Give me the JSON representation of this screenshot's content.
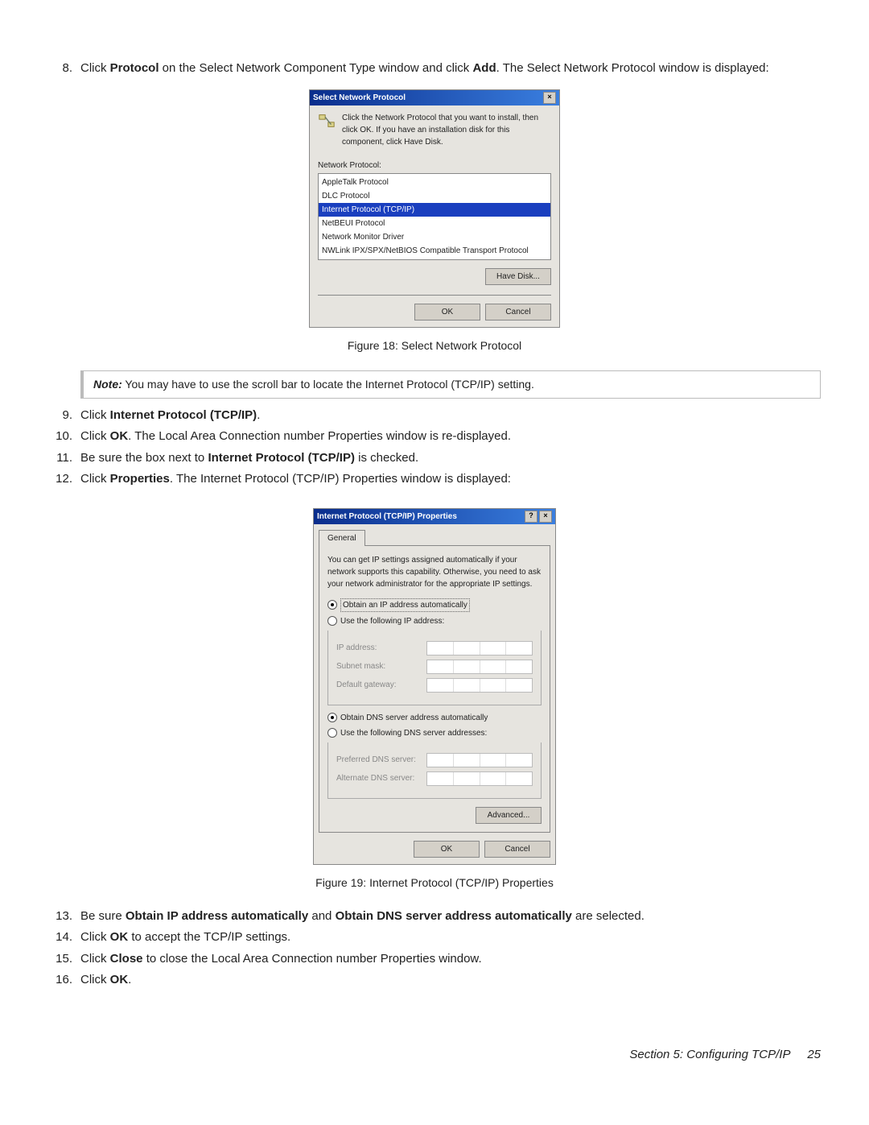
{
  "steps": {
    "s8_pre": "Click ",
    "s8_b1": "Protocol",
    "s8_mid": " on the Select Network Component Type window and click ",
    "s8_b2": "Add",
    "s8_post": ". The Select Network Protocol window is displayed:",
    "s9_pre": "Click ",
    "s9_b": "Internet Protocol (TCP/IP)",
    "s9_post": ".",
    "s10_pre": "Click ",
    "s10_b": "OK",
    "s10_post": ". The Local Area Connection number Properties window is re-displayed.",
    "s11_pre": "Be sure the box next to ",
    "s11_b": "Internet Protocol (TCP/IP)",
    "s11_post": " is checked.",
    "s12_pre": "Click ",
    "s12_b": "Properties",
    "s12_post": ". The Internet Protocol (TCP/IP) Properties window is displayed:",
    "s13_pre": "Be sure ",
    "s13_b1": "Obtain IP address automatically",
    "s13_mid": " and ",
    "s13_b2": "Obtain DNS server address automatically",
    "s13_post": " are selected.",
    "s14_pre": "Click ",
    "s14_b": "OK",
    "s14_post": " to accept the TCP/IP settings.",
    "s15_pre": "Click ",
    "s15_b": "Close",
    "s15_post": " to close the Local Area Connection number Properties window.",
    "s16_pre": "Click ",
    "s16_b": "OK",
    "s16_post": "."
  },
  "step_nums": {
    "n8": "8.",
    "n9": "9.",
    "n10": "10.",
    "n11": "11.",
    "n12": "12.",
    "n13": "13.",
    "n14": "14.",
    "n15": "15.",
    "n16": "16."
  },
  "captions": {
    "fig18": "Figure 18: Select Network Protocol",
    "fig19": "Figure 19: Internet Protocol (TCP/IP) Properties"
  },
  "note": {
    "label": "Note:",
    "text": " You may have to use the scroll bar to locate the Internet Protocol (TCP/IP) setting."
  },
  "dlg1": {
    "title": "Select Network Protocol",
    "info": "Click the Network Protocol that you want to install, then click OK. If you have an installation disk for this component, click Have Disk.",
    "list_label": "Network Protocol:",
    "items": {
      "i0": "AppleTalk Protocol",
      "i1": "DLC Protocol",
      "i2": "Internet Protocol (TCP/IP)",
      "i3": "NetBEUI Protocol",
      "i4": "Network Monitor Driver",
      "i5": "NWLink IPX/SPX/NetBIOS Compatible Transport Protocol"
    },
    "have_disk": "Have Disk...",
    "ok": "OK",
    "cancel": "Cancel"
  },
  "dlg2": {
    "title": "Internet Protocol (TCP/IP) Properties",
    "tab": "General",
    "desc": "You can get IP settings assigned automatically if your network supports this capability. Otherwise, you need to ask your network administrator for the appropriate IP settings.",
    "r1": "Obtain an IP address automatically",
    "r2": "Use the following IP address:",
    "ip_label": "IP address:",
    "mask_label": "Subnet mask:",
    "gw_label": "Default gateway:",
    "r3": "Obtain DNS server address automatically",
    "r4": "Use the following DNS server addresses:",
    "pref_dns": "Preferred DNS server:",
    "alt_dns": "Alternate DNS server:",
    "advanced": "Advanced...",
    "ok": "OK",
    "cancel": "Cancel",
    "close_sym": "×",
    "help_sym": "?"
  },
  "footer": {
    "section": "Section 5: Configuring TCP/IP",
    "page": "25"
  }
}
